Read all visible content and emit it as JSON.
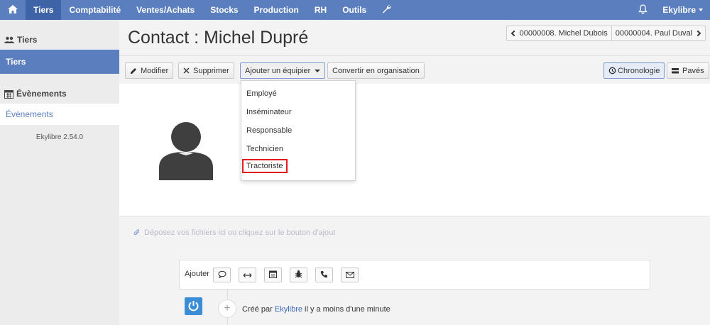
{
  "topbar": {
    "home_icon": "home-icon",
    "items": [
      {
        "label": "Tiers",
        "active": true
      },
      {
        "label": "Comptabilité"
      },
      {
        "label": "Ventes/Achats"
      },
      {
        "label": "Stocks"
      },
      {
        "label": "Production"
      },
      {
        "label": "RH"
      },
      {
        "label": "Outils"
      }
    ],
    "settings_icon": "wrench-icon",
    "notification_icon": "bell-icon",
    "user": "Ekylibre"
  },
  "sidebar": {
    "section1": "Tiers",
    "active_item": "Tiers",
    "section2": "Évènements",
    "link_item": "Évènements",
    "version": "Ekylibre 2.54.0"
  },
  "main": {
    "title": "Contact : Michel Dupré",
    "pager": {
      "prev": "00000008. Michel Dubois",
      "next": "00000004. Paul Duval"
    },
    "buttons": {
      "edit": "Modifier",
      "delete": "Supprimer",
      "add_team": "Ajouter un équipier",
      "convert": "Convertir en organisation",
      "timeline": "Chronologie",
      "tiles": "Pavés"
    },
    "dropdown": [
      "Employé",
      "Inséminateur",
      "Responsable",
      "Technicien",
      "Tractoriste"
    ],
    "dropzone": "Déposez vos fichiers ici ou cliquez sur le bouton d'ajout",
    "add_label": "Ajouter",
    "timeline_entry": {
      "prefix": "Créé par",
      "author": "Ekylibre",
      "suffix": "il y a moins d'une minute"
    }
  },
  "colors": {
    "accent": "#5b7fbe",
    "accent_dark": "#3e63a6",
    "highlight": "#e21d1d",
    "logo": "#3c8dd6"
  }
}
